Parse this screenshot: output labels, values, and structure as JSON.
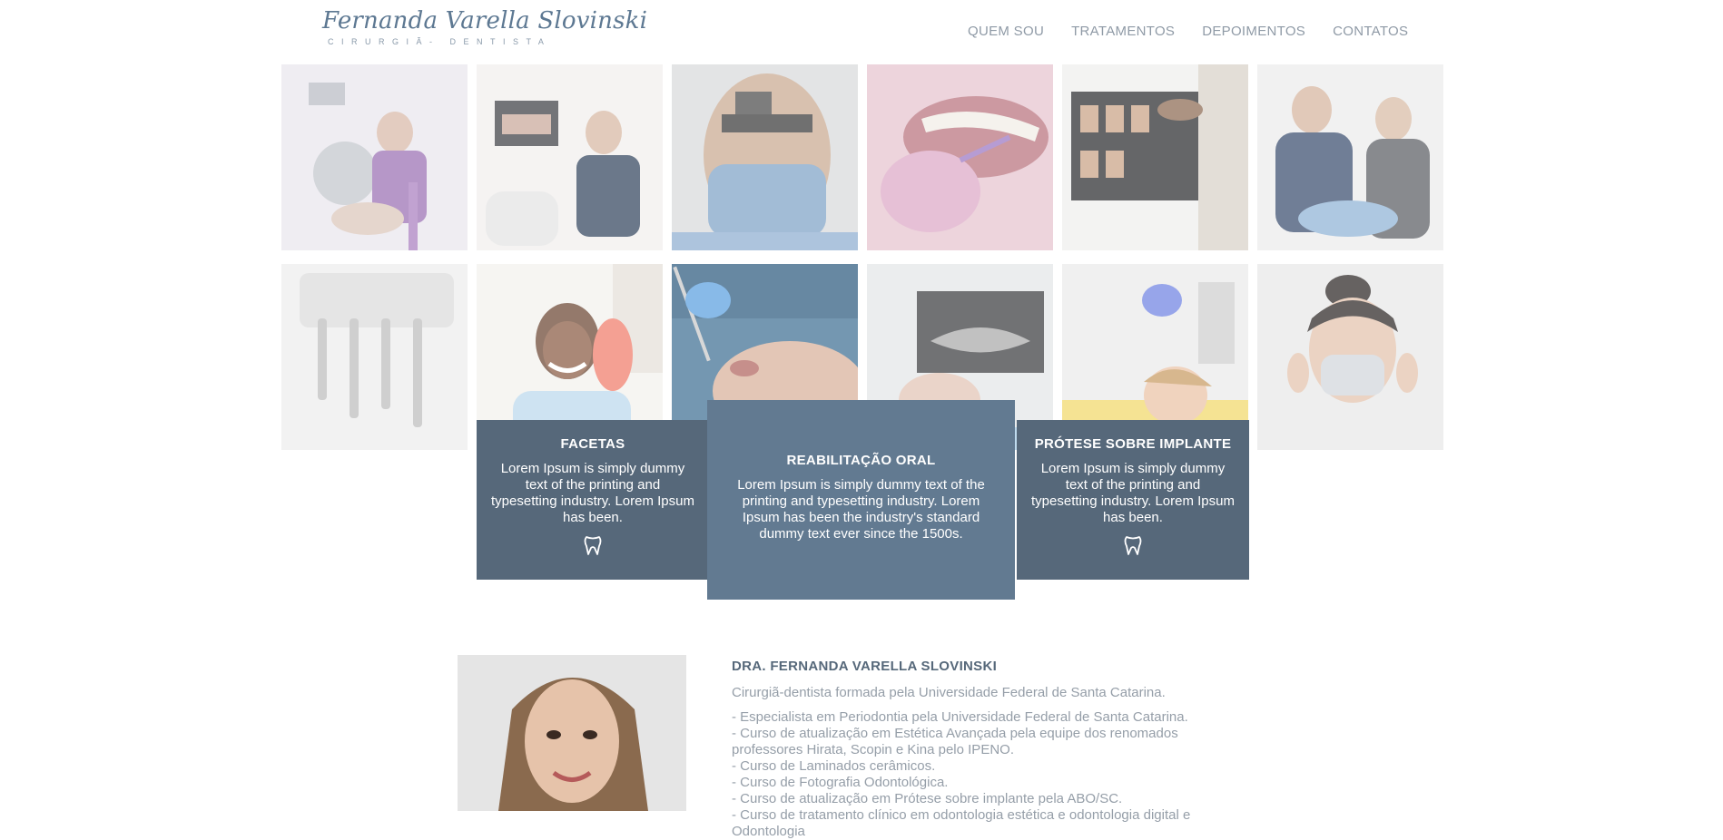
{
  "header": {
    "logo_name": "Fernanda Varella Slovinski",
    "logo_subtitle": "CIRURGIÃ- DENTISTA",
    "nav": [
      "QUEM SOU",
      "TRATAMENTOS",
      "DEPOIMENTOS",
      "CONTATOS"
    ]
  },
  "gallery": {
    "photos": [
      "dentist-with-microscope-photo",
      "dentist-at-xray-monitor-photo",
      "dentist-with-mask-closeup-photo",
      "gloved-mouth-exam-photo",
      "xray-film-review-photo",
      "dental-team-treating-patient-photo",
      "dental-chair-instruments-photo",
      "smiling-patient-with-mirror-photo",
      "patient-treatment-closeup-photo",
      "hands-holding-xray-photo",
      "child-patient-treatment-photo",
      "woman-putting-on-mask-photo"
    ]
  },
  "cards": [
    {
      "title": "FACETAS",
      "text": "Lorem Ipsum is simply dummy text of the printing and typesetting industry. Lorem Ipsum has been.",
      "icon": "tooth-icon"
    },
    {
      "title": "REABILITAÇÃO ORAL",
      "text": "Lorem Ipsum is simply dummy text of the printing and typesetting industry. Lorem Ipsum has been the industry's standard dummy text ever since the 1500s."
    },
    {
      "title": "PRÓTESE SOBRE IMPLANTE",
      "text": "Lorem Ipsum is simply dummy text of the printing and typesetting industry. Lorem Ipsum has been.",
      "icon": "tooth-icon"
    }
  ],
  "about": {
    "name": "DRA. FERNANDA VARELLA SLOVINSKI",
    "intro": "Cirurgiã-dentista formada pela Universidade Federal de Santa Catarina.",
    "items": [
      "- Especialista em Periodontia pela Universidade Federal de Santa Catarina.",
      "- Curso de atualização em Estética Avançada pela equipe dos renomados professores Hirata, Scopin e Kina pelo IPENO.",
      "- Curso de Laminados cerâmicos.",
      "- Curso de Fotografia Odontológica.",
      "- Curso de atualização em Prótese sobre implante pela ABO/SC.",
      "- Curso de tratamento clínico em odontologia estética e odontologia digital e Odontologia"
    ]
  },
  "colors": {
    "card_side": "#56687a",
    "card_main": "#627a91",
    "nav_text": "#8f9aa6",
    "logo": "#5d7892"
  }
}
